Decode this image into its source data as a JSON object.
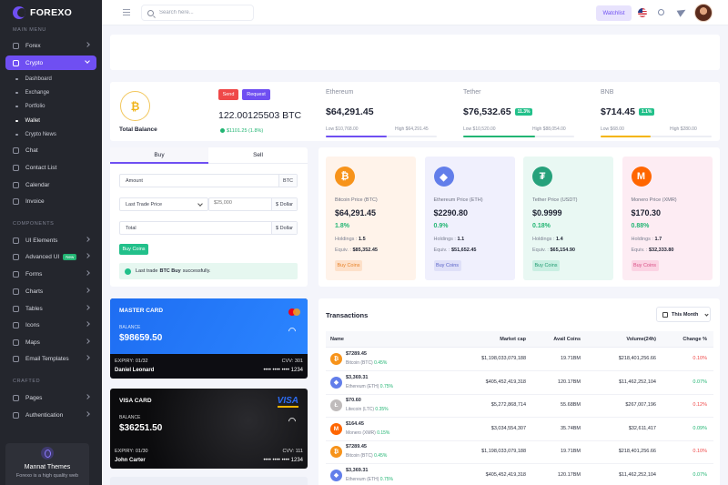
{
  "brand": {
    "name": "FOREXO"
  },
  "sidebar": {
    "sec_main": "MAIN MENU",
    "forex": "Forex",
    "crypto": "Crypto",
    "subs": [
      "Dashboard",
      "Exchange",
      "Portfolio",
      "Wallet",
      "Crypto News"
    ],
    "chat": "Chat",
    "contact": "Contact List",
    "calendar": "Calendar",
    "invoice": "Invoice",
    "sec_comp": "COMPONENTS",
    "ui": "UI Elements",
    "adv": "Advanced UI",
    "new_badge": "New",
    "forms": "Forms",
    "charts": "Charts",
    "tables": "Tables",
    "icons": "Icons",
    "maps": "Maps",
    "email": "Email Templates",
    "sec_crafted": "CRAFTED",
    "pages": "Pages",
    "auth": "Authentication",
    "promo_title": "Mannat Themes",
    "promo_sub": "Forexo is a high quality web"
  },
  "header": {
    "search_placeholder": "Search here...",
    "watchlist": "Watchlist"
  },
  "balance": {
    "coin": "₿",
    "label": "Total Balance",
    "send": "Send",
    "request": "Request",
    "amount": "122.00125503 BTC",
    "usd": "$1101.25 (1.8%)"
  },
  "tickers": [
    {
      "name": "Ethereum",
      "price": "$64,291.45",
      "badge": "",
      "low": "Low $10,768.00",
      "high": "High $64,291.45",
      "color": "#6f4ff2",
      "fill": 0.55
    },
    {
      "name": "Tether",
      "price": "$76,532.65",
      "badge": "11.3%",
      "low": "Low $10,520.00",
      "high": "High $88,054.00",
      "color": "#22b573",
      "fill": 0.65
    },
    {
      "name": "BNB",
      "price": "$714.45",
      "badge": "1.1%",
      "low": "Low $68.00",
      "high": "High $280.00",
      "color": "#f4b400",
      "fill": 0.45
    }
  ],
  "trade": {
    "tab_buy": "Buy",
    "tab_sell": "Sell",
    "amount": "Amount",
    "btc": "BTC",
    "last_trade": "Last Trade Price",
    "price_placeholder": "$25,000",
    "dollar": "$ Dollar",
    "total": "Total",
    "dollar2": "$ Dollar",
    "buy_btn": "Buy Coins",
    "alert_pre": "Last trade ",
    "alert_bold": "BTC Buy",
    "alert_post": " successfully."
  },
  "coins": [
    {
      "icon": "₿",
      "color": "#f7931a",
      "bg": "#fff3ea",
      "name": "Bitcoin Price (BTC)",
      "price": "$64,291.45",
      "pct": "1.8%",
      "hold_label": "Holdings :",
      "hold": "1.5",
      "eq_label": "Equiv. :",
      "eq": "$85,352.45",
      "btn": "Buy Coins",
      "btn_bg": "#fde0c9",
      "btn_color": "#e7832a"
    },
    {
      "icon": "◆",
      "color": "#627eea",
      "bg": "#f0f0fd",
      "name": "Ethereum Price (ETH)",
      "price": "$2290.80",
      "pct": "0.9%",
      "hold_label": "Holdings :",
      "hold": "1.1",
      "eq_label": "Equiv. :",
      "eq": "$51,652.45",
      "btn": "Buy Coins",
      "btn_bg": "#dfe0f8",
      "btn_color": "#5a63c9"
    },
    {
      "icon": "₮",
      "color": "#26a17b",
      "bg": "#e9f8f3",
      "name": "Tether Price (USDT)",
      "price": "$0.9999",
      "pct": "0.18%",
      "hold_label": "Holdings :",
      "hold": "1.4",
      "eq_label": "Equiv. :",
      "eq": "$65,154.90",
      "btn": "Buy Coins",
      "btn_bg": "#c9efe2",
      "btn_color": "#1f9a70"
    },
    {
      "icon": "M",
      "color": "#ff6600",
      "bg": "#fdecf3",
      "name": "Monero Price (XMR)",
      "price": "$170.30",
      "pct": "0.88%",
      "hold_label": "Holdings :",
      "hold": "1.7",
      "eq_label": "Equiv. :",
      "eq": "$32,333.80",
      "btn": "Buy Coins",
      "btn_bg": "#fbd3e3",
      "btn_color": "#d84f85"
    }
  ],
  "cards": [
    {
      "title": "MASTER CARD",
      "bal_label": "BALANCE",
      "bal": "$98659.50",
      "exp": "EXPIRY: 01/32",
      "cvv": "CVV: 301",
      "holder": "Daniel Leonard",
      "num": "•••• •••• •••• 1234"
    },
    {
      "title": "VISA CARD",
      "bal_label": "BALANCE",
      "bal": "$36251.50",
      "exp": "EXPIRY: 01/30",
      "cvv": "CVV: 111",
      "holder": "John Carter",
      "num": "•••• •••• •••• 1234",
      "brand": "VISA"
    }
  ],
  "tx": {
    "title": "Transactions",
    "filter": "This Month",
    "cols": [
      "Name",
      "Market cap",
      "Avail Coins",
      "Volume(24h)",
      "Change %"
    ],
    "rows": [
      {
        "icon": "₿",
        "color": "#f7931a",
        "price": "$7289.45",
        "name": "Bitcoin (BTC)",
        "pct": "0.45%",
        "cap": "$1,198,033,079,188",
        "avail": "19.71BM",
        "vol": "$218,401,256.66",
        "chg": "0.10%",
        "up": false
      },
      {
        "icon": "◆",
        "color": "#627eea",
        "price": "$3,369.31",
        "name": "Ethereum (ETH)",
        "pct": "0.75%",
        "cap": "$405,452,419,318",
        "avail": "120.17BM",
        "vol": "$11,462,252,104",
        "chg": "0.07%",
        "up": true
      },
      {
        "icon": "Ł",
        "color": "#bfbbbb",
        "price": "$70.60",
        "name": "Litecoin (LTC)",
        "pct": "0.35%",
        "cap": "$5,272,868,714",
        "avail": "55.68BM",
        "vol": "$267,007,196",
        "chg": "0.12%",
        "up": false
      },
      {
        "icon": "M",
        "color": "#ff6600",
        "price": "$164.45",
        "name": "Monero (XMR)",
        "pct": "0.15%",
        "cap": "$3,034,554,307",
        "avail": "35.74BM",
        "vol": "$32,611,417",
        "chg": "0.09%",
        "up": true
      },
      {
        "icon": "₿",
        "color": "#f7931a",
        "price": "$7289.45",
        "name": "Bitcoin (BTC)",
        "pct": "0.45%",
        "cap": "$1,198,033,079,188",
        "avail": "19.71BM",
        "vol": "$218,401,256.66",
        "chg": "0.10%",
        "up": false
      },
      {
        "icon": "◆",
        "color": "#627eea",
        "price": "$3,369.31",
        "name": "Ethereum (ETH)",
        "pct": "0.75%",
        "cap": "$405,452,419,318",
        "avail": "120.17BM",
        "vol": "$11,462,252,104",
        "chg": "0.07%",
        "up": true
      }
    ]
  }
}
